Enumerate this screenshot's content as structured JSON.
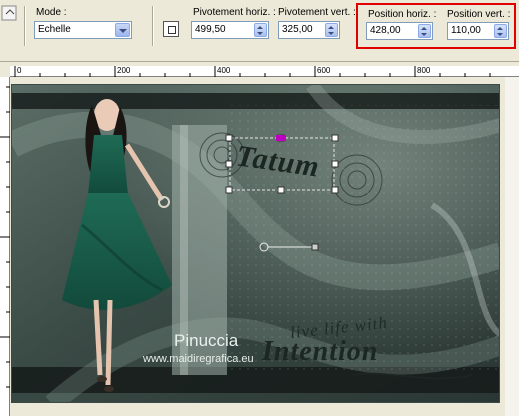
{
  "toolbar": {
    "mode_label": "Mode :",
    "mode_value": "Echelle",
    "rot_h_label": "Pivotement horiz. :",
    "rot_h_value": "499,50",
    "rot_v_label": "Pivotement vert. :",
    "rot_v_value": "325,00",
    "pos_h_label": "Position horiz. :",
    "pos_h_value": "428,00",
    "pos_v_label": "Position vert. :",
    "pos_v_value": "110,00"
  },
  "ruler": {
    "ticks": [
      "0",
      "200",
      "400",
      "600",
      "800"
    ]
  },
  "canvas": {
    "title_text": "Tatum",
    "tagline_1": "live life with",
    "tagline_2": "Intention",
    "signature": "Pinuccia",
    "website": "www.maidiregrafica.eu"
  },
  "colors": {
    "highlight": "#e00000",
    "toolbar_bg": "#ece9d8",
    "canvas_dark": "#2f3d39",
    "handle_magenta": "#c000c0"
  }
}
